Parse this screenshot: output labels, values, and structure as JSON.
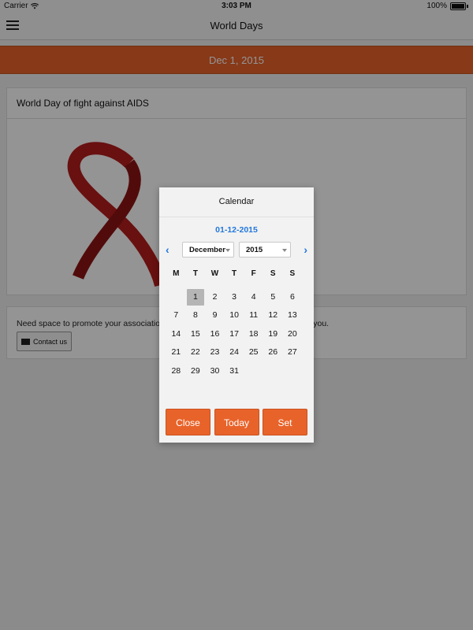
{
  "status_bar": {
    "carrier": "Carrier",
    "time": "3:03 PM",
    "battery": "100%"
  },
  "nav": {
    "title": "World Days"
  },
  "date_bar": {
    "label": "Dec 1, 2015"
  },
  "card": {
    "title": "World Day of fight against AIDS"
  },
  "promo": {
    "text": "Need space to promote your association in the world? This space is reserved for you.",
    "contact_label": "Contact us"
  },
  "calendar": {
    "title": "Calendar",
    "selected_date": "01-12-2015",
    "month": "December",
    "year": "2015",
    "weekdays": [
      "M",
      "T",
      "W",
      "T",
      "F",
      "S",
      "S"
    ],
    "days": [
      "",
      "1",
      "2",
      "3",
      "4",
      "5",
      "6",
      "7",
      "8",
      "9",
      "10",
      "11",
      "12",
      "13",
      "14",
      "15",
      "16",
      "17",
      "18",
      "19",
      "20",
      "21",
      "22",
      "23",
      "24",
      "25",
      "26",
      "27",
      "28",
      "29",
      "30",
      "31",
      "",
      "",
      ""
    ],
    "selected_day": "1",
    "buttons": {
      "close": "Close",
      "today": "Today",
      "set": "Set"
    }
  },
  "colors": {
    "accent": "#e8632a",
    "link": "#2277dd",
    "ribbon": "#b51c1c"
  }
}
